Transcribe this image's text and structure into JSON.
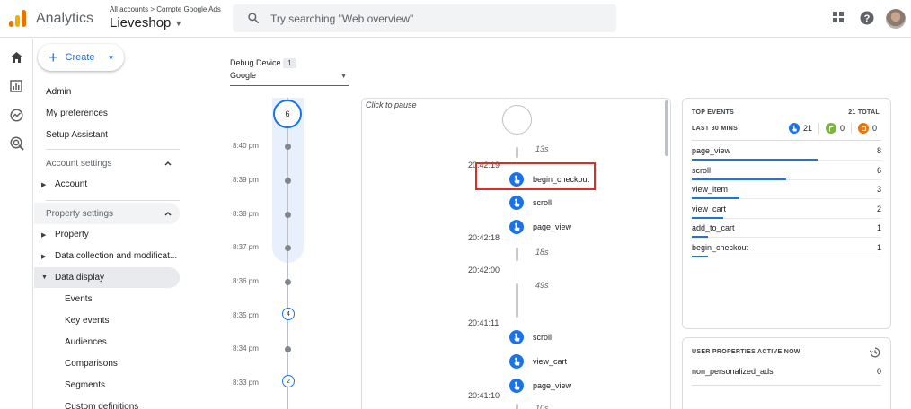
{
  "header": {
    "app_name": "Analytics",
    "account_path": "All accounts",
    "account_name": "Compte Google Ads",
    "property_name": "Lieveshop",
    "search_placeholder": "Try searching \"Web overview\""
  },
  "nav": {
    "create_label": "Create",
    "top_items": [
      "Admin",
      "My preferences",
      "Setup Assistant"
    ],
    "account_settings": {
      "title": "Account settings",
      "items": [
        "Account"
      ]
    },
    "property_settings": {
      "title": "Property settings",
      "items": [
        "Property",
        "Data collection and modificat...",
        "Data display"
      ],
      "data_display_children": [
        "Events",
        "Key events",
        "Audiences",
        "Comparisons",
        "Segments",
        "Custom definitions"
      ]
    }
  },
  "device": {
    "label": "Debug Device",
    "count": "1",
    "selected": "Google"
  },
  "minutes_timeline": {
    "current_count": "6",
    "rows": [
      {
        "time": "8:40 pm",
        "count": null
      },
      {
        "time": "8:39 pm",
        "count": null
      },
      {
        "time": "8:38 pm",
        "count": null
      },
      {
        "time": "8:37 pm",
        "count": null
      },
      {
        "time": "8:36 pm",
        "count": null
      },
      {
        "time": "8:35 pm",
        "count": "4"
      },
      {
        "time": "8:34 pm",
        "count": null
      },
      {
        "time": "8:33 pm",
        "count": "2"
      }
    ]
  },
  "stream": {
    "pause_hint": "Click to pause",
    "durations": [
      "13s",
      "18s",
      "49s",
      "10s"
    ],
    "timestamps": [
      "20:42:19",
      "20:42:18",
      "20:42:00",
      "20:41:11",
      "20:41:10"
    ],
    "events": [
      "begin_checkout",
      "scroll",
      "page_view",
      "scroll",
      "view_cart",
      "page_view"
    ]
  },
  "top_events": {
    "title": "TOP EVENTS",
    "total": "21 TOTAL",
    "subtitle": "LAST 30 MINS",
    "counters": {
      "events": "21",
      "key_events": "0",
      "errors": "0"
    },
    "rows": [
      {
        "name": "page_view",
        "count": "8",
        "value": 8
      },
      {
        "name": "scroll",
        "count": "6",
        "value": 6
      },
      {
        "name": "view_item",
        "count": "3",
        "value": 3
      },
      {
        "name": "view_cart",
        "count": "2",
        "value": 2
      },
      {
        "name": "add_to_cart",
        "count": "1",
        "value": 1
      },
      {
        "name": "begin_checkout",
        "count": "1",
        "value": 1
      }
    ]
  },
  "user_properties": {
    "title": "USER PROPERTIES ACTIVE NOW",
    "rows": [
      {
        "name": "non_personalized_ads",
        "value": "0"
      }
    ]
  },
  "colors": {
    "accent": "#1a73e8",
    "highlight_box": "#d93025",
    "key_event": "#7cb342",
    "error": "#e8710a"
  }
}
